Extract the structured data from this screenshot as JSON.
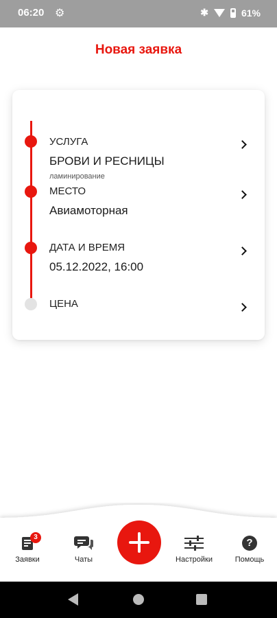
{
  "status_bar": {
    "time": "06:20",
    "battery": "61%",
    "icons": [
      "gear-icon",
      "bluetooth-icon",
      "wifi-icon",
      "battery-icon"
    ]
  },
  "page": {
    "title": "Новая заявка"
  },
  "steps": [
    {
      "label": "УСЛУГА",
      "value": "БРОВИ И РЕСНИЦЫ",
      "sub": "ламинирование",
      "completed": true
    },
    {
      "label": "МЕСТО",
      "value": "Авиамоторная",
      "completed": true
    },
    {
      "label": "ДАТА И ВРЕМЯ",
      "value": "05.12.2022, 16:00",
      "completed": true
    },
    {
      "label": "ЦЕНА",
      "completed": false
    }
  ],
  "bottom_nav": {
    "items": [
      {
        "label": "Заявки",
        "icon": "requests-icon",
        "badge": "3"
      },
      {
        "label": "Чаты",
        "icon": "chat-icon"
      },
      {
        "label": "Настройки",
        "icon": "settings-sliders-icon"
      },
      {
        "label": "Помощь",
        "icon": "help-icon",
        "glyph": "?"
      }
    ],
    "add_icon": "plus-icon"
  },
  "colors": {
    "accent": "#e8170f",
    "inactive_dot": "#e3e3e3",
    "status_bar": "#9e9e9e"
  }
}
